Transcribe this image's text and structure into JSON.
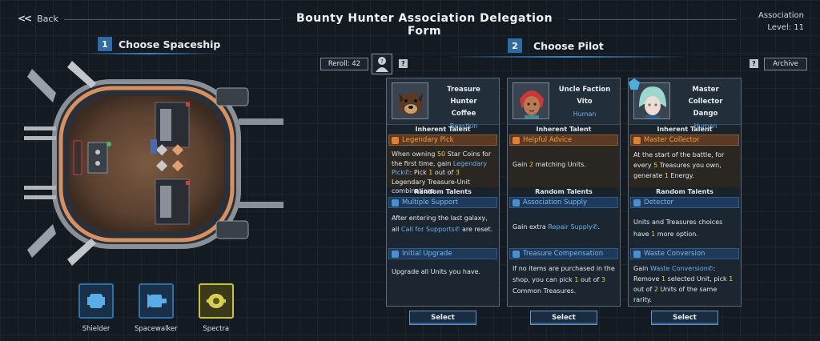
{
  "header": {
    "back_label": "Back",
    "title": "Bounty Hunter Association Delegation Form",
    "association_label": "Association",
    "level_label": "Level: 11"
  },
  "spaceship_section": {
    "number": "1",
    "title": "Choose Spaceship",
    "ships": [
      {
        "label": "Shielder",
        "icon": "shield-ship-icon",
        "selected": false
      },
      {
        "label": "Spacewalker",
        "icon": "walker-ship-icon",
        "selected": false
      },
      {
        "label": "Spectra",
        "icon": "spectra-ship-icon",
        "selected": true
      }
    ]
  },
  "pilot_section": {
    "number": "2",
    "title": "Choose Pilot",
    "reroll_label": "Reroll: 42",
    "help_label": "?",
    "archive_label": "Archive",
    "inherent_label": "Inherent Talent",
    "random_label": "Random Talents",
    "select_label": "Select"
  },
  "pilots": [
    {
      "title": "Treasure Hunter",
      "name": "Coffee",
      "race": "Beastkin",
      "inherent_name": "Legendary Pick",
      "inherent_desc": {
        "a": "When owning ",
        "n1": "50",
        "b": " Star Coins for the first time, gain ",
        "link": "Legendary Pick",
        "c": ": Pick ",
        "n2": "1",
        "d": " out of ",
        "n3": "3",
        "e": " Legendary Treasure-Unit combinations."
      },
      "random1_name": "Multiple Support",
      "random1_desc": {
        "a": "After entering the last galaxy, all ",
        "link": "Call for Supports",
        "b": " are reset."
      },
      "random2_name": "Initial Upgrade",
      "random2_desc": "Upgrade all Units you have."
    },
    {
      "title": "Uncle Faction",
      "name": "Vito",
      "race": "Human",
      "inherent_name": "Helpful Advice",
      "inherent_desc": {
        "a": "Gain ",
        "n1": "2",
        "b": " matching Units."
      },
      "random1_name": "Association Supply",
      "random1_desc": {
        "a": "Gain extra ",
        "link": "Repair Supply",
        "b": "."
      },
      "random2_name": "Treasure Compensation",
      "random2_desc": {
        "a": "If no items are purchased in the shop, you can pick ",
        "n1": "1",
        "b": " out of ",
        "n2": "3",
        "c": " Common Treasures."
      }
    },
    {
      "title": "Master Collector",
      "name": "Dango",
      "race": "Human",
      "inherent_name": "Master Collector",
      "inherent_desc": {
        "a": "At the start of the battle, for every ",
        "n1": "5",
        "b": " Treasures you own, generate ",
        "n2": "1",
        "c": " Energy."
      },
      "random1_name": "Detector",
      "random1_desc": {
        "a": "Units and Treasures choices have ",
        "n1": "1",
        "b": " more option."
      },
      "random2_name": "Waste Conversion",
      "random2_desc": {
        "a": "Gain ",
        "link": "Waste Conversion",
        "b": ": Remove ",
        "n1": "1",
        "c": " selected Unit, pick ",
        "n2": "1",
        "d": " out of ",
        "n3": "2",
        "e": " Units of the same rarity."
      }
    }
  ]
}
